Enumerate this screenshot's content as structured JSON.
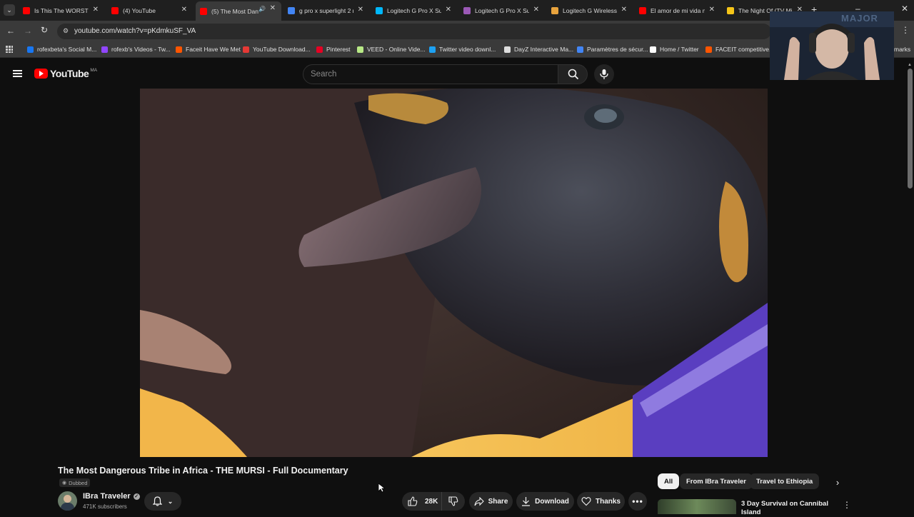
{
  "browser": {
    "tabs": [
      {
        "title": "Is This The WORST M",
        "favicon": "youtube-icon",
        "color": "#ff0000"
      },
      {
        "title": "(4) YouTube",
        "favicon": "youtube-icon",
        "color": "#ff0000"
      },
      {
        "title": "(5) The Most Dan",
        "favicon": "youtube-icon",
        "color": "#ff0000"
      },
      {
        "title": "g pro x superlight 2 n",
        "favicon": "google-icon",
        "color": "#4285f4"
      },
      {
        "title": "Logitech G Pro X Sup",
        "favicon": "logitech-icon",
        "color": "#00b8fc"
      },
      {
        "title": "Logitech G Pro X Sup",
        "favicon": "logitech-icon",
        "color": "#9b59b6"
      },
      {
        "title": "Logitech G Wireless G",
        "favicon": "store-icon",
        "color": "#e8a33d"
      },
      {
        "title": "El amor de mi vida m",
        "favicon": "youtube-icon",
        "color": "#ff0000"
      },
      {
        "title": "The Night Of (TV Mi",
        "favicon": "imdb-icon",
        "color": "#f5c518"
      }
    ],
    "url": "youtube.com/watch?v=pKdmkuSF_VA",
    "bookmarks": [
      {
        "label": "rofexbeta's Social M...",
        "color": "#1877f2"
      },
      {
        "label": "rofexb's Videos - Tw...",
        "color": "#9146ff"
      },
      {
        "label": "Faceit Have We Met",
        "color": "#ff5500"
      },
      {
        "label": "YouTube Download...",
        "color": "#e53935"
      },
      {
        "label": "Pinterest",
        "color": "#e60023"
      },
      {
        "label": "VEED - Online Vide...",
        "color": "#b8e986"
      },
      {
        "label": "Twitter video downl...",
        "color": "#1da1f2"
      },
      {
        "label": "DayZ Interactive Ma...",
        "color": "#dddddd"
      },
      {
        "label": "Paramètres de sécur...",
        "color": "#4285f4"
      },
      {
        "label": "Home / Twitter",
        "color": "#ffffff"
      },
      {
        "label": "FACEIT competitive...",
        "color": "#ff5500"
      }
    ],
    "bookmarks_overflow": "marks"
  },
  "youtube": {
    "logo_text": "YouTube",
    "region": "MA",
    "search_placeholder": "Search",
    "video_title": "The Most Dangerous Tribe in Africa - THE MURSI - Full Documentary",
    "dubbed_label": "Dubbed",
    "channel_name": "IBra Traveler",
    "subscribers": "471K subscribers",
    "likes": "28K",
    "share_label": "Share",
    "download_label": "Download",
    "thanks_label": "Thanks",
    "chips": [
      "All",
      "From IBra Traveler",
      "Travel to Ethiopia"
    ],
    "rec_title_line1": "3 Day Survival on Cannibal",
    "rec_title_line2": "Island"
  },
  "webcam_text": "MAJOR"
}
